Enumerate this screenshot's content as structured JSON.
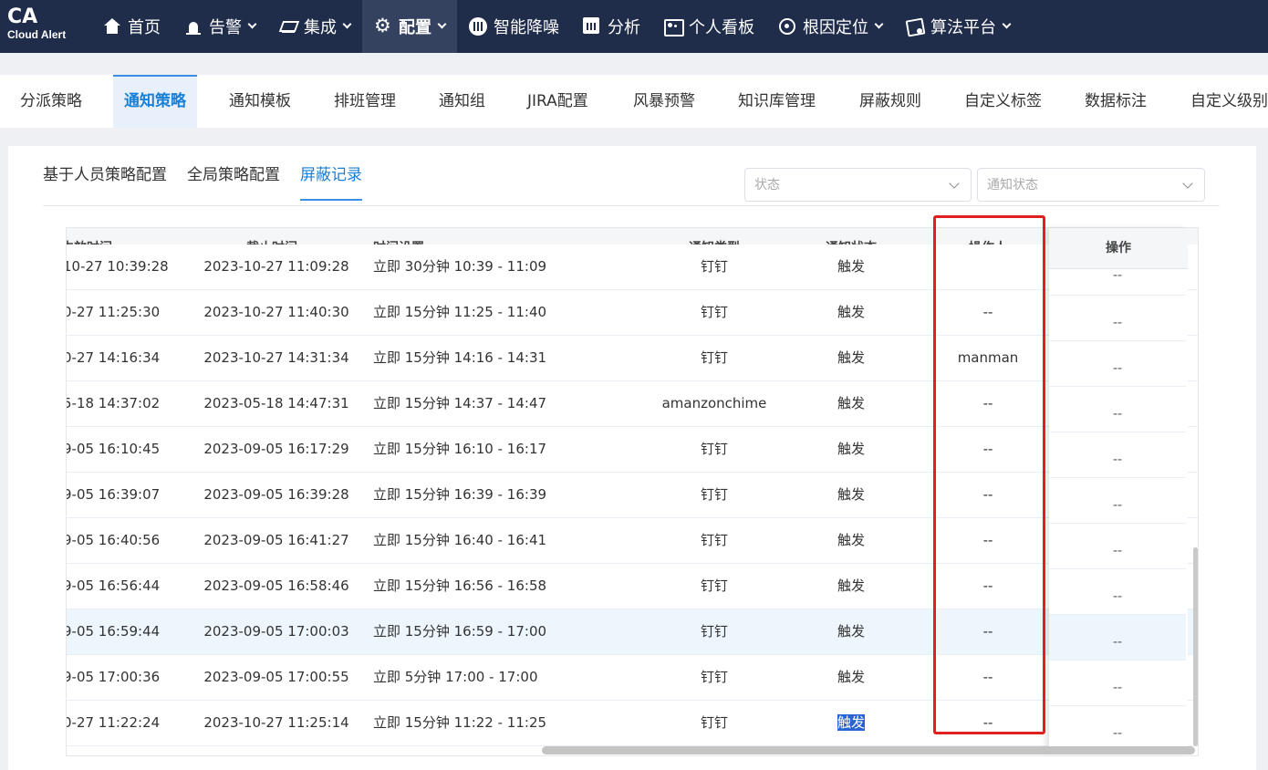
{
  "logo": {
    "big": "CA",
    "small": "Cloud Alert"
  },
  "nav": [
    {
      "label": "首页",
      "icon": "home-icon",
      "dropdown": false,
      "active": false
    },
    {
      "label": "告警",
      "icon": "alarm-icon",
      "dropdown": true,
      "active": false
    },
    {
      "label": "集成",
      "icon": "layers-icon",
      "dropdown": true,
      "active": false
    },
    {
      "label": "配置",
      "icon": "gear-icon",
      "dropdown": true,
      "active": true
    },
    {
      "label": "智能降噪",
      "icon": "waveform-icon",
      "dropdown": false,
      "active": false
    },
    {
      "label": "分析",
      "icon": "bar-chart-icon",
      "dropdown": false,
      "active": false
    },
    {
      "label": "个人看板",
      "icon": "dashboard-icon",
      "dropdown": false,
      "active": false
    },
    {
      "label": "根因定位",
      "icon": "target-icon",
      "dropdown": true,
      "active": false
    },
    {
      "label": "算法平台",
      "icon": "algorithm-icon",
      "dropdown": true,
      "active": false
    }
  ],
  "tabs": [
    "分派策略",
    "通知策略",
    "通知模板",
    "排班管理",
    "通知组",
    "JIRA配置",
    "风暴预警",
    "知识库管理",
    "屏蔽规则",
    "自定义标签",
    "数据标注",
    "自定义级别"
  ],
  "active_tab": "通知策略",
  "subtabs": [
    "基于人员策略配置",
    "全局策略配置",
    "屏蔽记录"
  ],
  "active_subtab": "屏蔽记录",
  "filters": {
    "status_placeholder": "状态",
    "notify_status_placeholder": "通知状态"
  },
  "table": {
    "headers": {
      "start": "生效时间",
      "end": "截止时间",
      "setting": "时间设置",
      "type": "通知类型",
      "status": "通知状态",
      "operator": "操作人",
      "action": "操作"
    },
    "partial_row": {
      "start": "10-27 10:39:28",
      "end": "2023-10-27 11:09:28",
      "setting": "立即 30分钟 10:39 - 11:09",
      "type": "钉钉",
      "status": "触发"
    },
    "rows": [
      {
        "start": "0-27 11:25:30",
        "end": "2023-10-27 11:40:30",
        "setting": "立即 15分钟 11:25 - 11:40",
        "type": "钉钉",
        "status": "触发",
        "operator": "--",
        "action": "--"
      },
      {
        "start": "0-27 14:16:34",
        "end": "2023-10-27 14:31:34",
        "setting": "立即 15分钟 14:16 - 14:31",
        "type": "钉钉",
        "status": "触发",
        "operator": "manman",
        "action": "--"
      },
      {
        "start": "5-18 14:37:02",
        "end": "2023-05-18 14:47:31",
        "setting": "立即 15分钟 14:37 - 14:47",
        "type": "amanzonchime",
        "status": "触发",
        "operator": "--",
        "action": "--"
      },
      {
        "start": "9-05 16:10:45",
        "end": "2023-09-05 16:17:29",
        "setting": "立即 15分钟 16:10 - 16:17",
        "type": "钉钉",
        "status": "触发",
        "operator": "--",
        "action": "--"
      },
      {
        "start": "9-05 16:39:07",
        "end": "2023-09-05 16:39:28",
        "setting": "立即 15分钟 16:39 - 16:39",
        "type": "钉钉",
        "status": "触发",
        "operator": "--",
        "action": "--"
      },
      {
        "start": "9-05 16:40:56",
        "end": "2023-09-05 16:41:27",
        "setting": "立即 15分钟 16:40 - 16:41",
        "type": "钉钉",
        "status": "触发",
        "operator": "--",
        "action": "--"
      },
      {
        "start": "9-05 16:56:44",
        "end": "2023-09-05 16:58:46",
        "setting": "立即 15分钟 16:56 - 16:58",
        "type": "钉钉",
        "status": "触发",
        "operator": "--",
        "action": "--"
      },
      {
        "start": "9-05 16:59:44",
        "end": "2023-09-05 17:00:03",
        "setting": "立即 15分钟 16:59 - 17:00",
        "type": "钉钉",
        "status": "触发",
        "operator": "--",
        "action": "--",
        "highlight": true
      },
      {
        "start": "9-05 17:00:36",
        "end": "2023-09-05 17:00:55",
        "setting": "立即 5分钟 17:00 - 17:00",
        "type": "钉钉",
        "status": "触发",
        "operator": "--",
        "action": "--"
      },
      {
        "start": "0-27 11:22:24",
        "end": "2023-10-27 11:25:14",
        "setting": "立即 15分钟 11:22 - 11:25",
        "type": "钉钉",
        "status": "触发",
        "operator": "--",
        "action": "--",
        "status_selected": true
      }
    ],
    "fixed_first_action": "--"
  },
  "colors": {
    "nav_bg": "#1f2d4b",
    "accent": "#1a7fd6",
    "annotation_box": "#e02020",
    "row_highlight": "#edf6fd"
  }
}
